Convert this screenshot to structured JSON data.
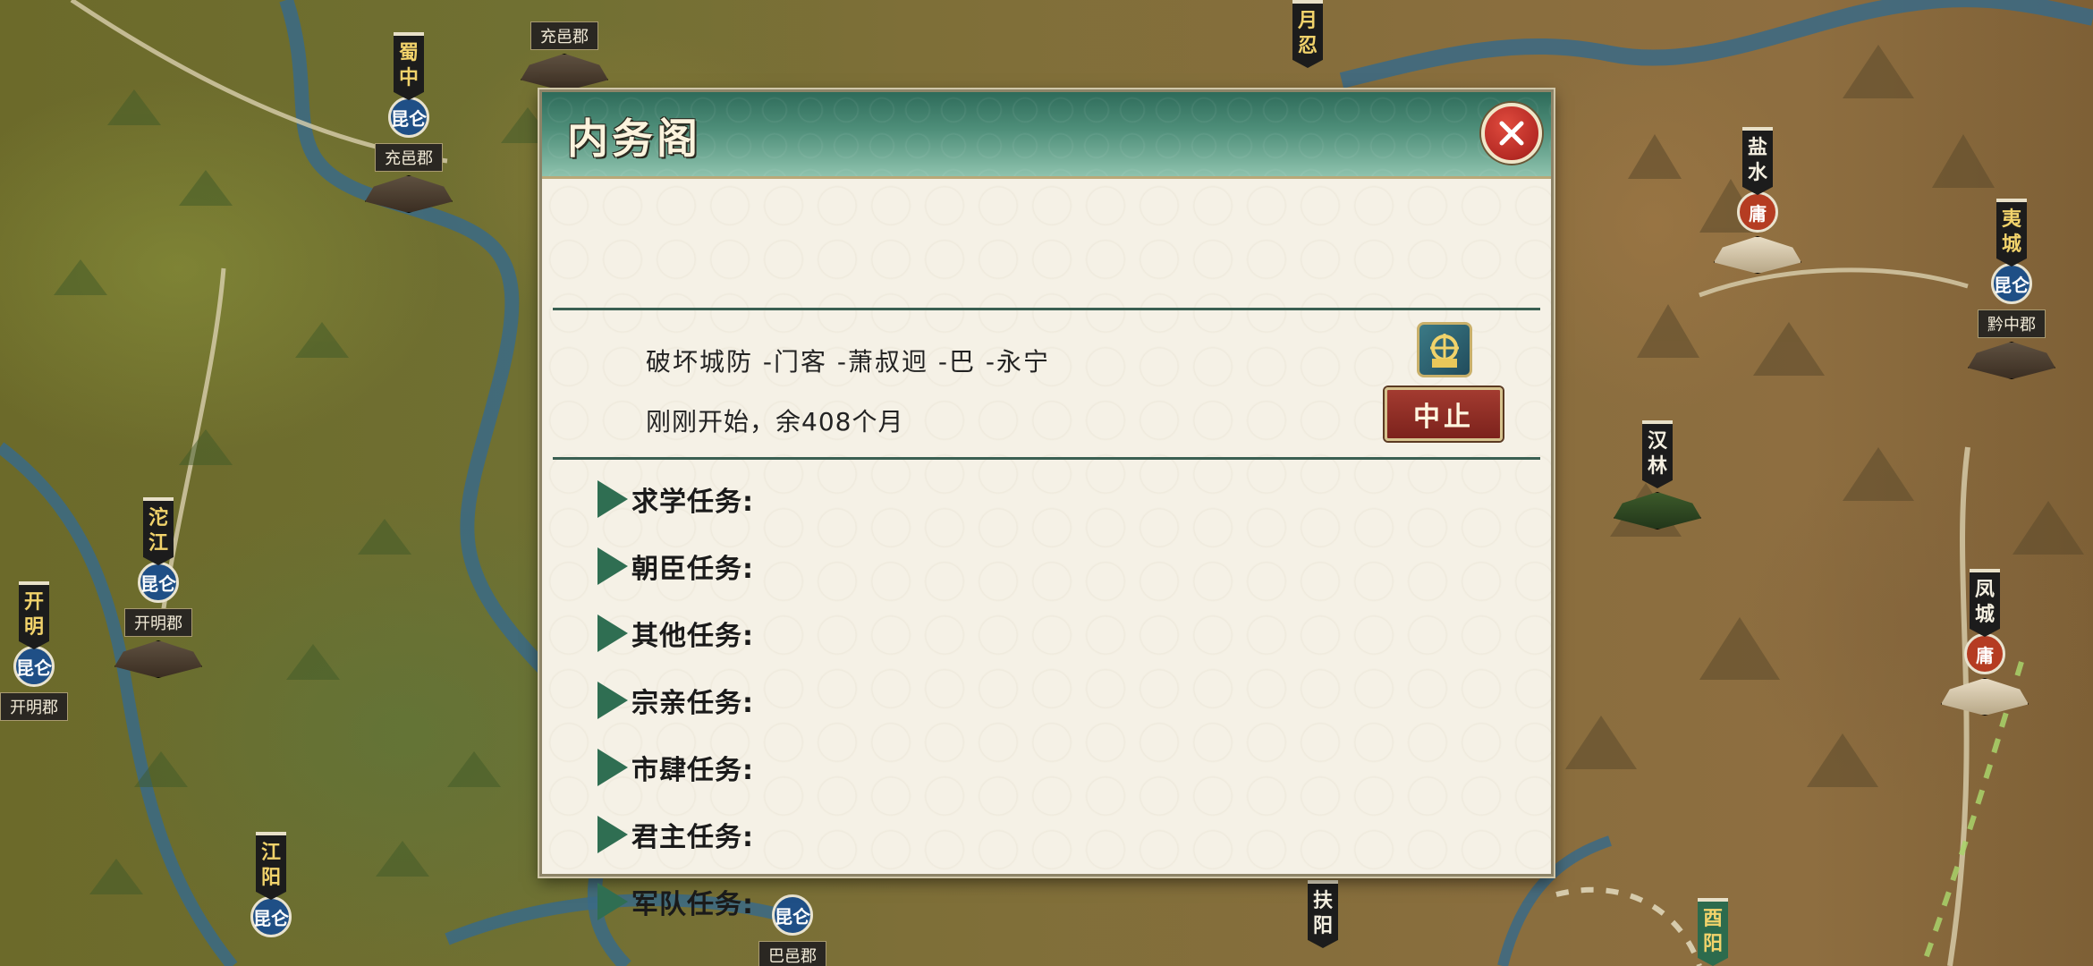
{
  "dialog": {
    "title": "内务阁",
    "task_name": "破坏城防 -门客 -萧叔迥 -巴 -永宁",
    "task_status": "刚刚开始，余408个月",
    "stop_label": "中止",
    "task_icon_label": "建造",
    "categories": [
      {
        "label": "求学任务:"
      },
      {
        "label": "朝臣任务:"
      },
      {
        "label": "其他任务:"
      },
      {
        "label": "宗亲任务:"
      },
      {
        "label": "市肆任务:"
      },
      {
        "label": "君主任务:"
      },
      {
        "label": "军队任务:"
      }
    ]
  },
  "map": {
    "cities": [
      {
        "name": "蜀中",
        "badge": "昆仑",
        "label": "充邑郡"
      },
      {
        "name": "沱江",
        "badge": "昆仑",
        "label": "开明郡"
      },
      {
        "name": "开明",
        "badge": "昆仑",
        "label": "开明郡"
      },
      {
        "name": "江阳",
        "badge": "昆仑"
      },
      {
        "name": "月忍"
      },
      {
        "name": "盐水",
        "badge": "庸"
      },
      {
        "name": "夷城",
        "badge": "昆仑",
        "label": "黔中郡"
      },
      {
        "name": "汉林"
      },
      {
        "name": "凤城",
        "badge": "庸"
      },
      {
        "name": "扶阳"
      },
      {
        "name": "酉阳"
      },
      {
        "name": "巴邑郡",
        "badge": "昆仑"
      },
      {
        "name": "充邑郡"
      }
    ]
  },
  "colors": {
    "header_teal": "#2e6b5a",
    "stop_red": "#8e2a22",
    "triangle_green": "#2f6e52",
    "close_red": "#c23a30"
  }
}
